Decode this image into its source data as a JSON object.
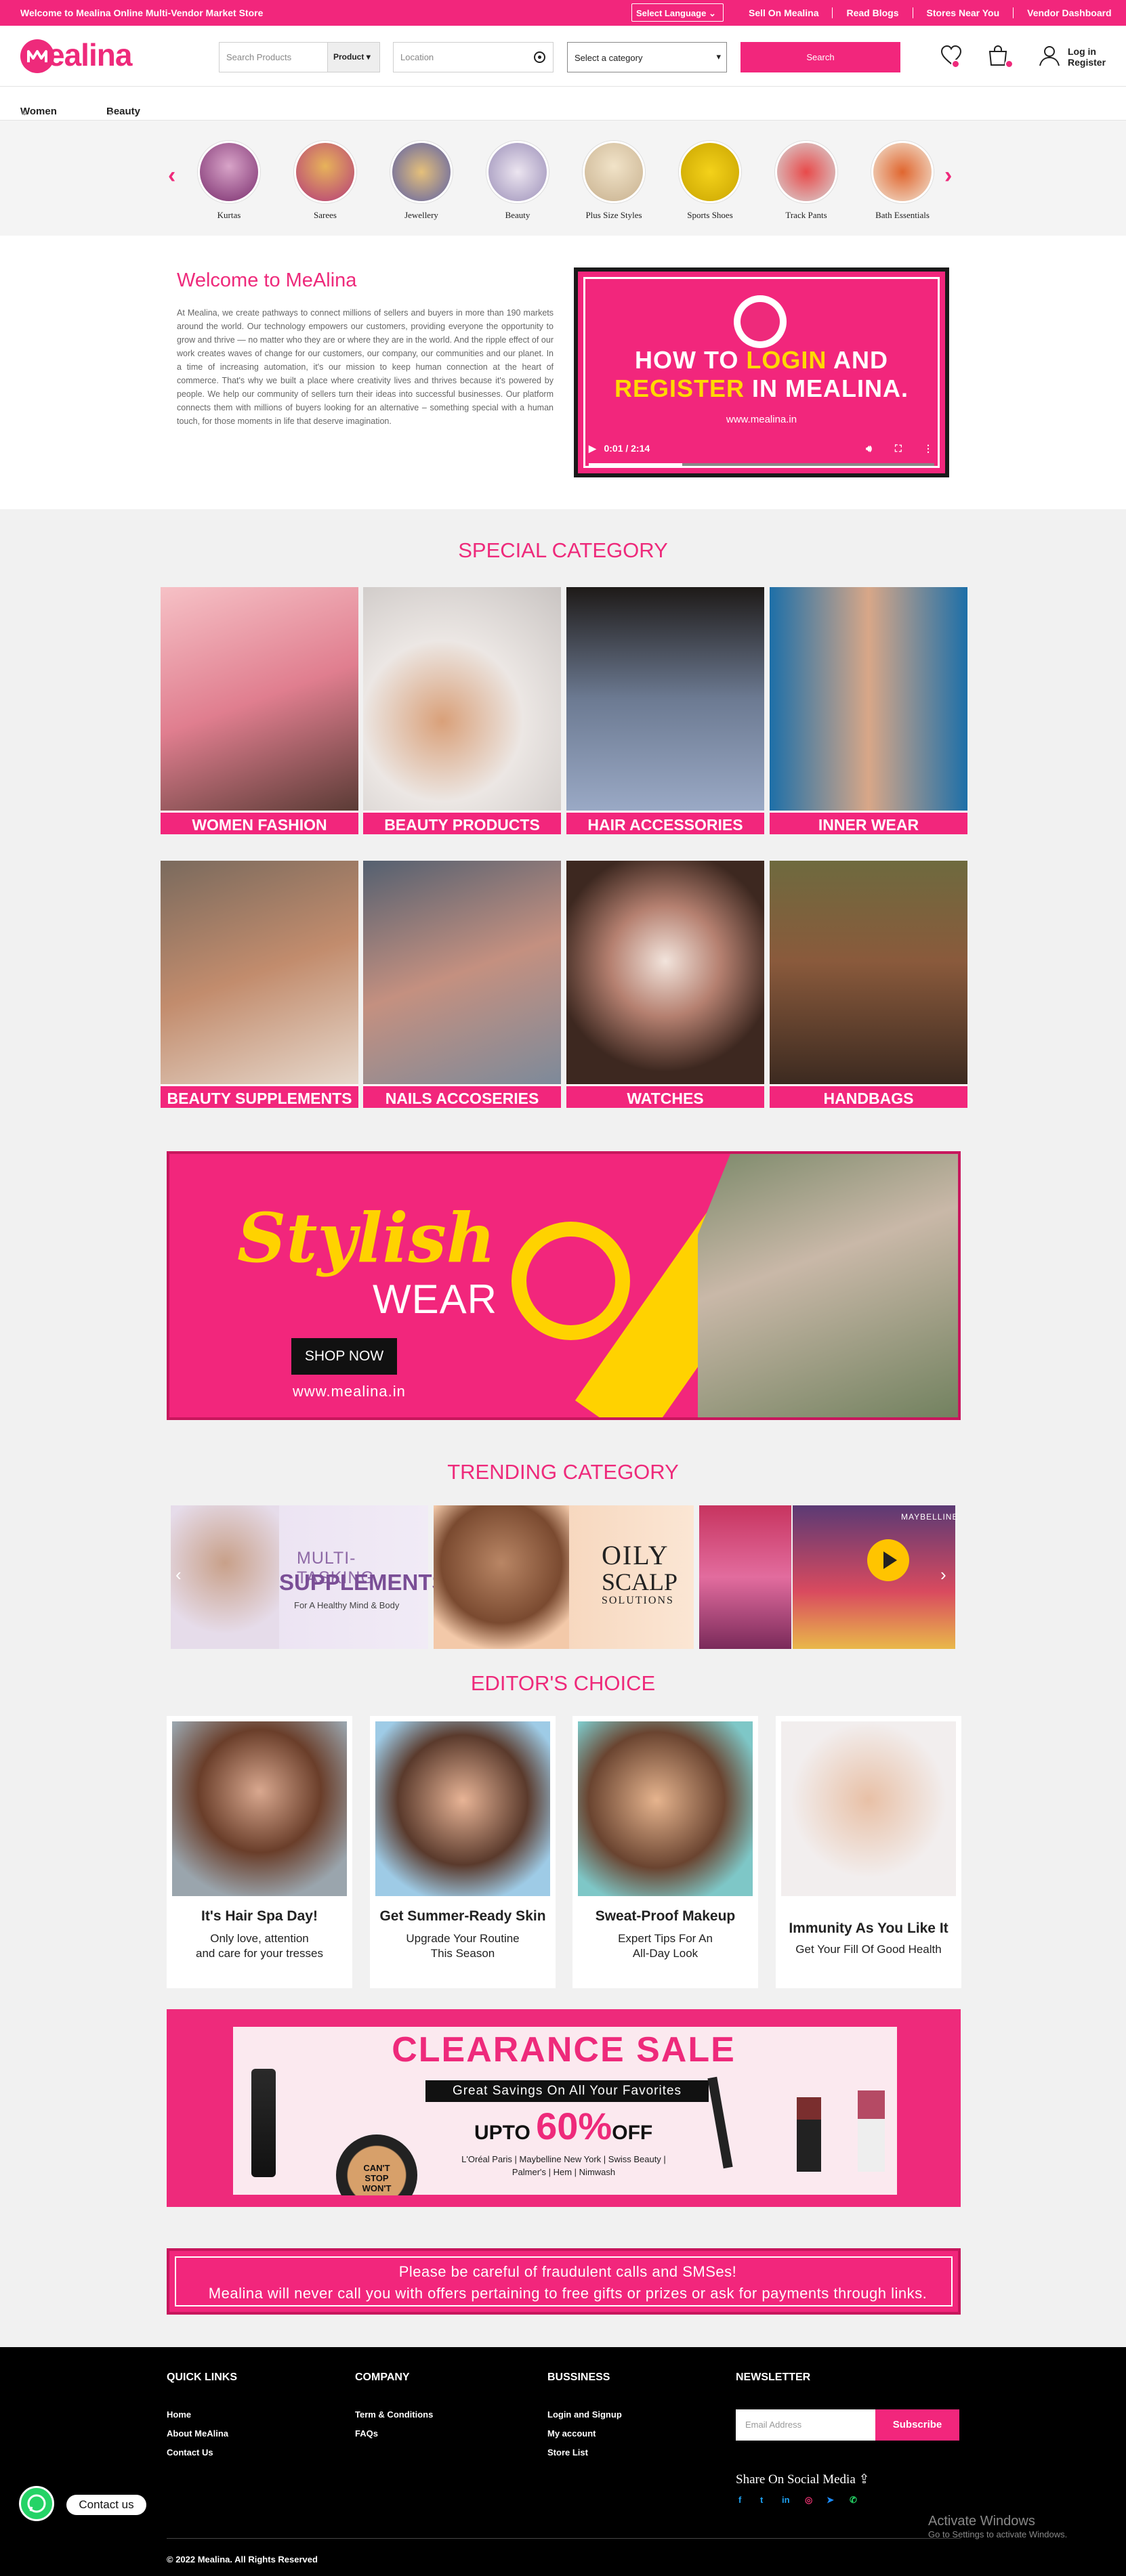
{
  "topbar": {
    "welcome": "Welcome to Mealina Online Multi-Vendor Market Store",
    "language": "Select Language",
    "links": [
      "Sell On Mealina",
      "Read Blogs",
      "Stores Near You",
      "Vendor Dashboard"
    ]
  },
  "header": {
    "logo": "ealina",
    "search_placeholder": "Search Products",
    "product_select": "Product",
    "location_placeholder": "Location",
    "category_select": "Select a category",
    "search_button": "Search",
    "login": "Log in",
    "register": "Register"
  },
  "nav": {
    "items": [
      "Women",
      "Beauty"
    ]
  },
  "categories": [
    {
      "label": "Kurtas"
    },
    {
      "label": "Sarees"
    },
    {
      "label": "Jewellery"
    },
    {
      "label": "Beauty"
    },
    {
      "label": "Plus Size Styles"
    },
    {
      "label": "Sports Shoes"
    },
    {
      "label": "Track Pants"
    },
    {
      "label": "Bath Essentials"
    }
  ],
  "welcome": {
    "title": "Welcome to MeAlina",
    "text": "At Mealina, we create pathways to connect millions of sellers and buyers in more than 190 markets around the world. Our technology empowers our customers, providing everyone the opportunity to grow and thrive — no matter who they are or where they are in the world. And the ripple effect of our work creates waves of change for our customers, our company, our communities and our planet. In a time of increasing automation, it's our mission to keep human connection at the heart of commerce. That's why we built a place where creativity lives and thrives because it's powered by people. We help our community of sellers turn their ideas into successful businesses. Our platform connects them with millions of buyers looking for an alternative – something special with a human touch, for those moments in life that deserve imagination."
  },
  "video": {
    "line1_a": "HOW TO ",
    "line1_b": "LOGIN",
    "line1_c": " AND",
    "line2_a": "REGISTER",
    "line2_b": " IN MEALINA.",
    "url": "www.mealina.in",
    "time": "0:01 / 2:14",
    "progress": 0.27
  },
  "special": {
    "title": "SPECIAL CATEGORY",
    "tiles": [
      "WOMEN FASHION",
      "BEAUTY PRODUCTS",
      "HAIR ACCESSORIES",
      "INNER WEAR",
      "BEAUTY SUPPLEMENTS",
      "NAILS ACCOSERIES",
      "WATCHES",
      "HANDBAGS"
    ]
  },
  "stylish": {
    "t1": "Stylish",
    "t2": "WEAR",
    "shop": "SHOP NOW",
    "url": "www.mealina.in"
  },
  "trending": {
    "title": "TRENDING CATEGORY",
    "b1_a": "MULTI-TASKING",
    "b1_b": "SUPPLEMENTS",
    "b1_c": "For A Healthy Mind & Body",
    "b2_a": "OILY",
    "b2_b": "SCALP",
    "b2_c": "SOLUTIONS",
    "b3": "MAYBELLINE"
  },
  "editors": {
    "title": "EDITOR'S CHOICE",
    "cards": [
      {
        "h": "It's Hair Spa Day!",
        "p1": "Only love, attention",
        "p2": "and care for your tresses"
      },
      {
        "h": "Get Summer-Ready Skin",
        "p1": "Upgrade Your Routine",
        "p2": "This Season"
      },
      {
        "h": "Sweat-Proof Makeup",
        "p1": "Expert Tips For An",
        "p2": "All-Day Look"
      },
      {
        "h": "Immunity As You Like It",
        "p1": "Get Your Fill Of Good Health",
        "p2": ""
      }
    ]
  },
  "clearance": {
    "title": "CLEARANCE SALE",
    "sub": "Great Savings On All Your Favorites",
    "upto": "UPTO",
    "pct": "60%",
    "off": "OFF",
    "brands1": "L'Oréal Paris | Maybelline New York | Swiss Beauty |",
    "brands2": "Palmer's | Hem | Nimwash",
    "product": "CAN'T STOP WON'T STOP"
  },
  "fraud": {
    "l1": "Please be careful of fraudulent calls and SMSes!",
    "l2": "Mealina will never call you with offers pertaining to free gifts or prizes or ask for payments through links."
  },
  "footer": {
    "quick": {
      "h": "QUICK LINKS",
      "items": [
        "Home",
        "About MeAlina",
        "Contact Us"
      ]
    },
    "company": {
      "h": "COMPANY",
      "items": [
        "Term & Conditions",
        "FAQs"
      ]
    },
    "business": {
      "h": "BUSSINESS",
      "items": [
        "Login and Signup",
        "My account",
        "Store List"
      ]
    },
    "newsletter": {
      "h": "NEWSLETTER",
      "email_placeholder": "Email Address",
      "subscribe": "Subscribe",
      "share": "Share On Social Media"
    },
    "copyright": "© 2022 Mealina. All Rights Reserved",
    "contact": "Contact us"
  },
  "windows": {
    "l1": "Activate Windows",
    "l2": "Go to Settings to activate Windows."
  },
  "colors": {
    "brand": "#f2267c",
    "accent": "#ffd200"
  }
}
